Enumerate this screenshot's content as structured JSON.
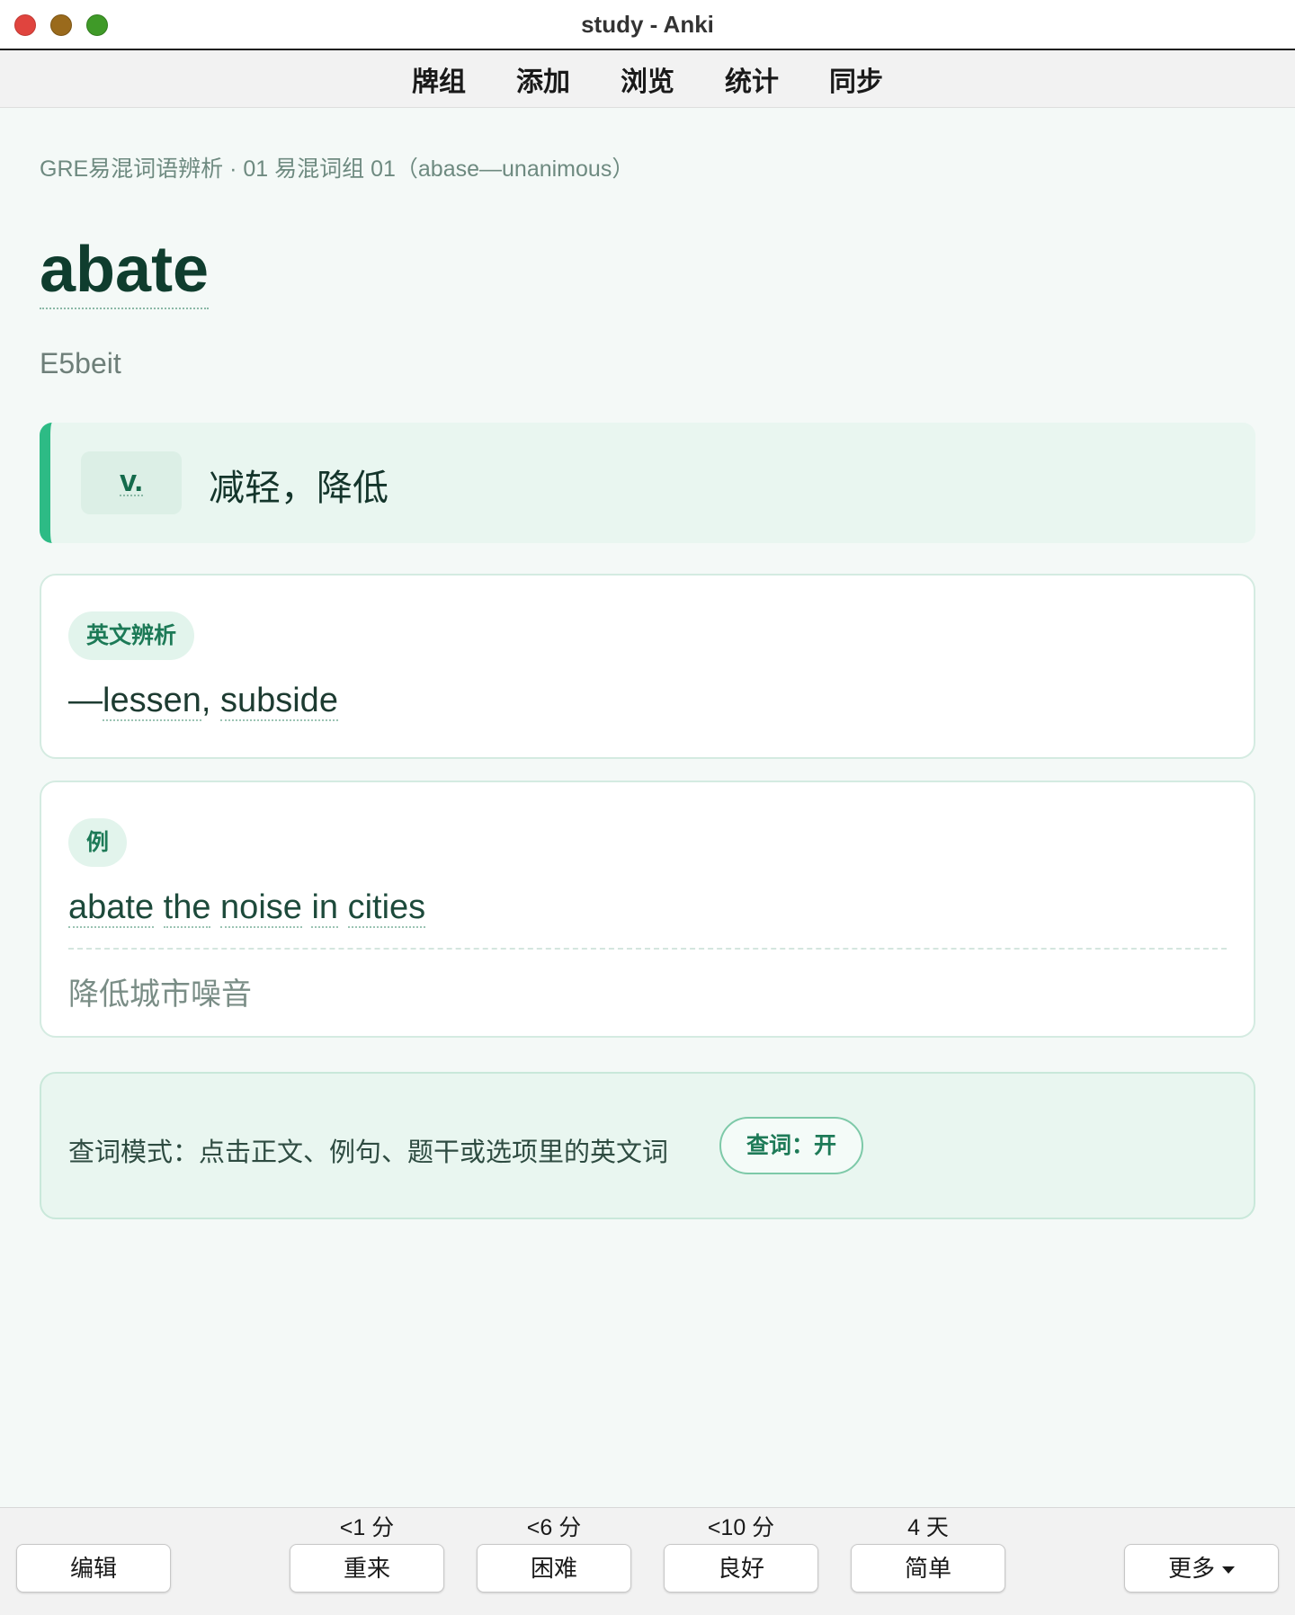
{
  "window": {
    "title": "study - Anki"
  },
  "toolbar": {
    "items": [
      "牌组",
      "添加",
      "浏览",
      "统计",
      "同步"
    ]
  },
  "card": {
    "breadcrumb": "GRE易混词语辨析 · 01 易混词组 01（abase—unanimous）",
    "word": "abate",
    "phonetic": "E5beit",
    "pos": "v.",
    "definition": "减轻，降低",
    "analysis_tag": "英文辨析",
    "analysis_dash": "—",
    "analysis_word1": "lessen",
    "analysis_comma": ", ",
    "analysis_word2": "subside",
    "example_tag": "例",
    "example_en_words": [
      "abate",
      "the",
      "noise",
      "in",
      "cities"
    ],
    "example_zh": "降低城市噪音"
  },
  "lookup": {
    "text": "查词模式：点击正文、例句、题干或选项里的英文词",
    "toggle_label": "查词：开"
  },
  "bottom": {
    "edit_label": "编辑",
    "answers": [
      {
        "interval": "<1 分",
        "label": "重来"
      },
      {
        "interval": "<6 分",
        "label": "困难"
      },
      {
        "interval": "<10 分",
        "label": "良好"
      },
      {
        "interval": "4 天",
        "label": "简单"
      }
    ],
    "more_label": "更多"
  },
  "colors": {
    "accent": "#2dbb85",
    "headword": "#0f3d2e",
    "tag_text": "#1d7a57"
  }
}
